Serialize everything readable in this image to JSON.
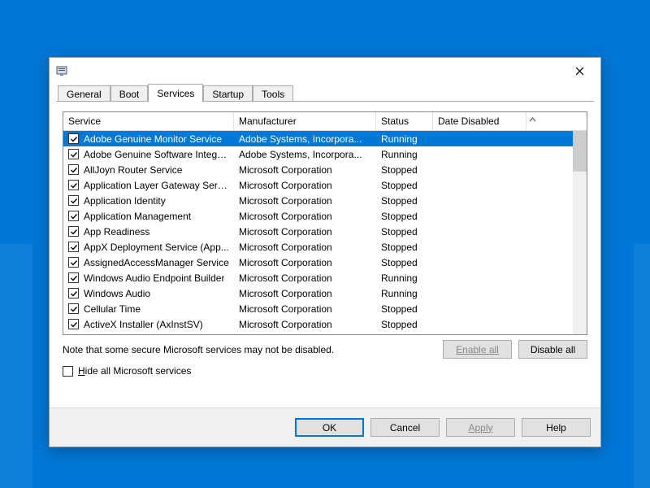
{
  "window": {
    "title": ""
  },
  "tabs": [
    "General",
    "Boot",
    "Services",
    "Startup",
    "Tools"
  ],
  "active_tab": 2,
  "columns": {
    "service": "Service",
    "manufacturer": "Manufacturer",
    "status": "Status",
    "date_disabled": "Date Disabled"
  },
  "rows": [
    {
      "checked": true,
      "service": "Adobe Genuine Monitor Service",
      "manufacturer": "Adobe Systems, Incorpora...",
      "status": "Running",
      "date_disabled": "",
      "selected": true
    },
    {
      "checked": true,
      "service": "Adobe Genuine Software Integri...",
      "manufacturer": "Adobe Systems, Incorpora...",
      "status": "Running",
      "date_disabled": ""
    },
    {
      "checked": true,
      "service": "AllJoyn Router Service",
      "manufacturer": "Microsoft Corporation",
      "status": "Stopped",
      "date_disabled": ""
    },
    {
      "checked": true,
      "service": "Application Layer Gateway Service",
      "manufacturer": "Microsoft Corporation",
      "status": "Stopped",
      "date_disabled": ""
    },
    {
      "checked": true,
      "service": "Application Identity",
      "manufacturer": "Microsoft Corporation",
      "status": "Stopped",
      "date_disabled": ""
    },
    {
      "checked": true,
      "service": "Application Management",
      "manufacturer": "Microsoft Corporation",
      "status": "Stopped",
      "date_disabled": ""
    },
    {
      "checked": true,
      "service": "App Readiness",
      "manufacturer": "Microsoft Corporation",
      "status": "Stopped",
      "date_disabled": ""
    },
    {
      "checked": true,
      "service": "AppX Deployment Service (App...",
      "manufacturer": "Microsoft Corporation",
      "status": "Stopped",
      "date_disabled": ""
    },
    {
      "checked": true,
      "service": "AssignedAccessManager Service",
      "manufacturer": "Microsoft Corporation",
      "status": "Stopped",
      "date_disabled": ""
    },
    {
      "checked": true,
      "service": "Windows Audio Endpoint Builder",
      "manufacturer": "Microsoft Corporation",
      "status": "Running",
      "date_disabled": ""
    },
    {
      "checked": true,
      "service": "Windows Audio",
      "manufacturer": "Microsoft Corporation",
      "status": "Running",
      "date_disabled": ""
    },
    {
      "checked": true,
      "service": "Cellular Time",
      "manufacturer": "Microsoft Corporation",
      "status": "Stopped",
      "date_disabled": ""
    },
    {
      "checked": true,
      "service": "ActiveX Installer (AxInstSV)",
      "manufacturer": "Microsoft Corporation",
      "status": "Stopped",
      "date_disabled": ""
    }
  ],
  "note": "Note that some secure Microsoft services may not be disabled.",
  "enable_all_label": "Enable all",
  "disable_all_label": "Disable all",
  "hide_ms_label_prefix": "H",
  "hide_ms_label_rest": "ide all Microsoft services",
  "hide_ms_checked": false,
  "buttons": {
    "ok": "OK",
    "cancel": "Cancel",
    "apply": "Apply",
    "help": "Help"
  }
}
